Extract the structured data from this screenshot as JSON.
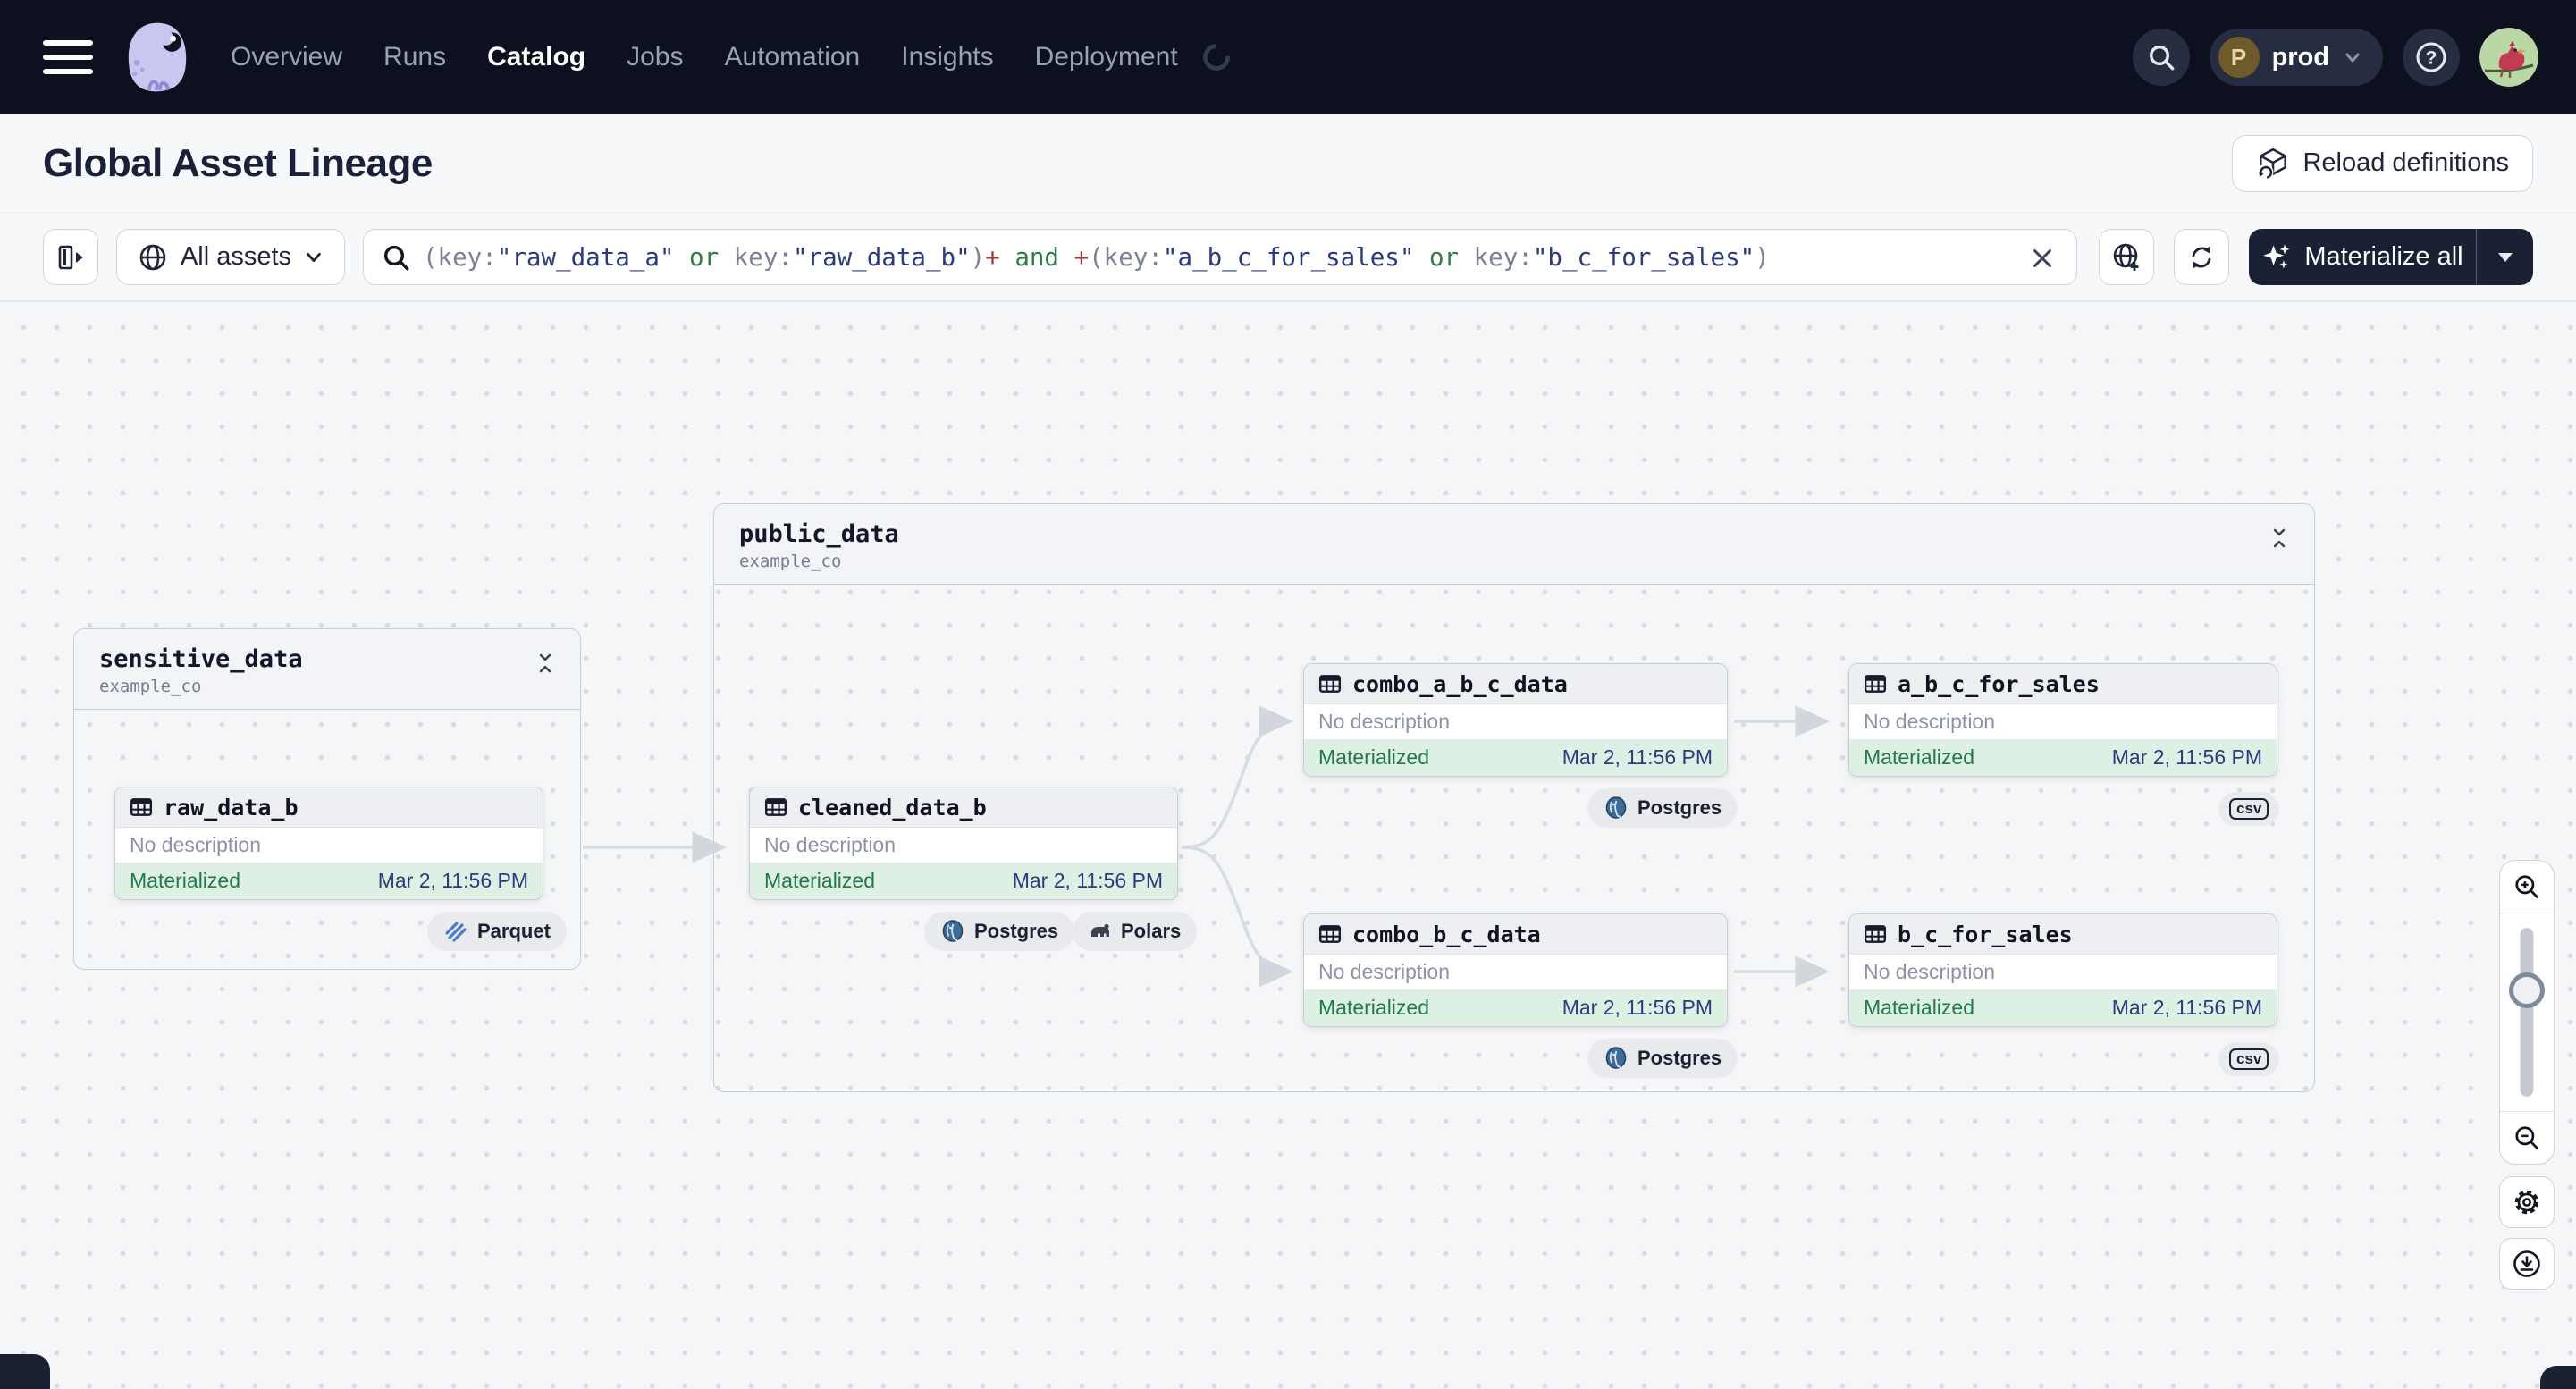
{
  "nav": {
    "menu_items": [
      {
        "label": "Overview"
      },
      {
        "label": "Runs"
      },
      {
        "label": "Catalog"
      },
      {
        "label": "Jobs"
      },
      {
        "label": "Automation"
      },
      {
        "label": "Insights"
      },
      {
        "label": "Deployment"
      }
    ],
    "active_item": "Catalog",
    "environment": {
      "initial": "P",
      "name": "prod"
    }
  },
  "header": {
    "title": "Global Asset Lineage",
    "reload_button": "Reload definitions"
  },
  "toolbar": {
    "scope": {
      "label": "All assets"
    },
    "search": {
      "segments": [
        {
          "text": "(key:",
          "kind": "punct"
        },
        {
          "text": "\"raw_data_a\"",
          "kind": "string"
        },
        {
          "text": " or ",
          "kind": "keyword"
        },
        {
          "text": "key:",
          "kind": "punct"
        },
        {
          "text": "\"raw_data_b\"",
          "kind": "string"
        },
        {
          "text": ")",
          "kind": "punct"
        },
        {
          "text": "+",
          "kind": "plus"
        },
        {
          "text": " and ",
          "kind": "keyword"
        },
        {
          "text": "+",
          "kind": "plus"
        },
        {
          "text": "(key:",
          "kind": "punct"
        },
        {
          "text": "\"a_b_c_for_sales\"",
          "kind": "string"
        },
        {
          "text": " or ",
          "kind": "keyword"
        },
        {
          "text": "key:",
          "kind": "punct"
        },
        {
          "text": "\"b_c_for_sales\"",
          "kind": "string"
        },
        {
          "text": ")",
          "kind": "punct"
        }
      ]
    },
    "materialize_button": "Materialize all"
  },
  "graph": {
    "groups": [
      {
        "name": "sensitive_data",
        "repo": "example_co"
      },
      {
        "name": "public_data",
        "repo": "example_co"
      }
    ],
    "nodes": [
      {
        "title": "raw_data_b",
        "description": "No description",
        "status": "Materialized",
        "timestamp": "Mar 2, 11:56 PM",
        "badges": [
          "Parquet"
        ]
      },
      {
        "title": "cleaned_data_b",
        "description": "No description",
        "status": "Materialized",
        "timestamp": "Mar 2, 11:56 PM",
        "badges": [
          "Postgres",
          "Polars"
        ]
      },
      {
        "title": "combo_a_b_c_data",
        "description": "No description",
        "status": "Materialized",
        "timestamp": "Mar 2, 11:56 PM",
        "badges": [
          "Postgres"
        ]
      },
      {
        "title": "a_b_c_for_sales",
        "description": "No description",
        "status": "Materialized",
        "timestamp": "Mar 2, 11:56 PM",
        "badges": [
          "csv"
        ]
      },
      {
        "title": "combo_b_c_data",
        "description": "No description",
        "status": "Materialized",
        "timestamp": "Mar 2, 11:56 PM",
        "badges": [
          "Postgres"
        ]
      },
      {
        "title": "b_c_for_sales",
        "description": "No description",
        "status": "Materialized",
        "timestamp": "Mar 2, 11:56 PM",
        "badges": [
          "csv"
        ]
      }
    ]
  },
  "colors": {
    "nav_bg": "#0c101f",
    "materialized_green": "#21794a",
    "timestamp_blue": "#2e3a7f",
    "materialized_bg": "#def0e4",
    "dark_button": "#1b2135"
  }
}
